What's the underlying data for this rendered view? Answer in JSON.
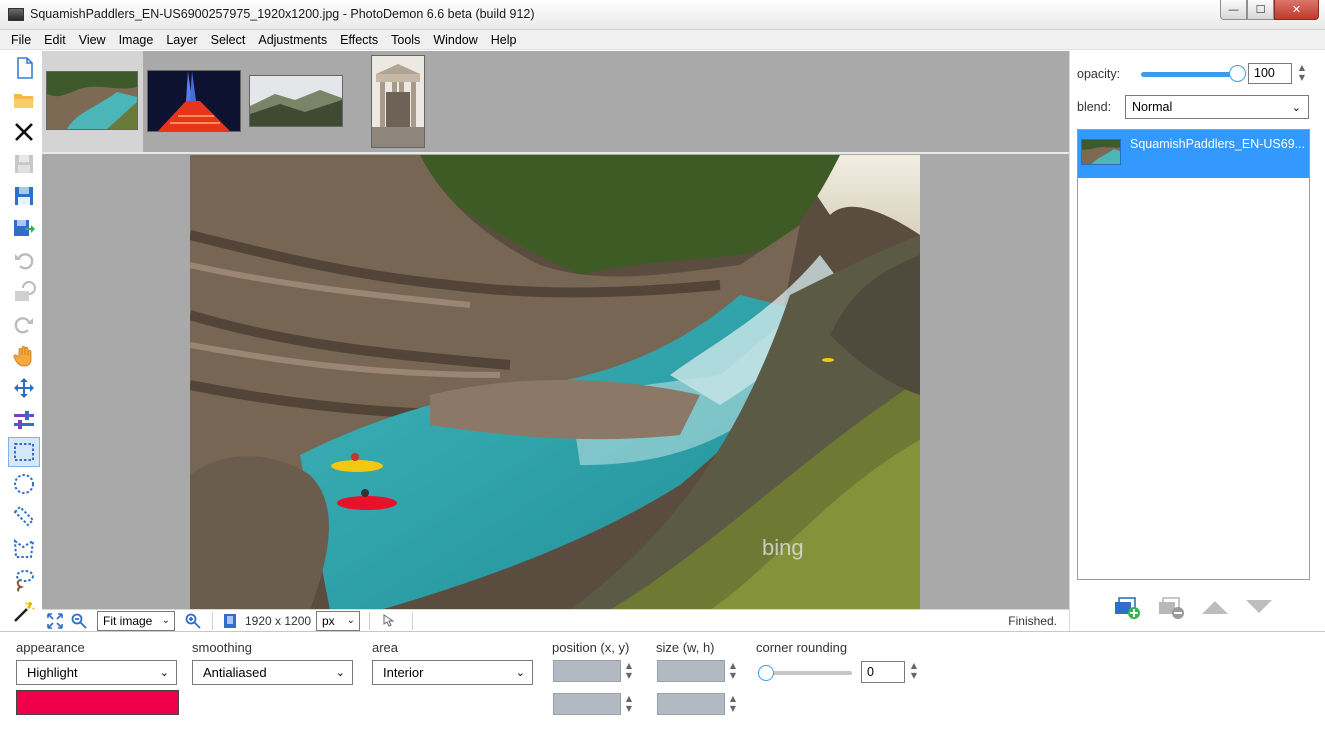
{
  "window": {
    "title": "SquamishPaddlers_EN-US6900257975_1920x1200.jpg  -  PhotoDemon 6.6 beta (build 912)",
    "minimize_glyph": "—",
    "maximize_glyph": "☐",
    "close_glyph": "✕"
  },
  "menu": [
    "File",
    "Edit",
    "View",
    "Image",
    "Layer",
    "Select",
    "Adjustments",
    "Effects",
    "Tools",
    "Window",
    "Help"
  ],
  "tools": [
    {
      "name": "new-image-icon"
    },
    {
      "name": "open-folder-icon"
    },
    {
      "name": "close-image-icon"
    },
    {
      "name": "save-icon"
    },
    {
      "name": "save-as-icon"
    },
    {
      "name": "export-icon"
    },
    {
      "name": "undo-icon"
    },
    {
      "name": "fade-icon"
    },
    {
      "name": "redo-icon"
    },
    {
      "name": "hand-icon"
    },
    {
      "name": "move-icon"
    },
    {
      "name": "color-picker-icon"
    },
    {
      "name": "rect-select-icon"
    },
    {
      "name": "ellipse-select-icon"
    },
    {
      "name": "line-select-icon"
    },
    {
      "name": "polygon-select-icon"
    },
    {
      "name": "lasso-select-icon"
    },
    {
      "name": "magic-wand-icon"
    }
  ],
  "thumbnails": [
    "river canyon",
    "tower at night",
    "mountain valley",
    "classical building"
  ],
  "statusbar": {
    "zoom_mode": "Fit image",
    "image_size": "1920 x 1200",
    "units": "px",
    "status": "Finished."
  },
  "layers_panel": {
    "opacity_label": "opacity:",
    "opacity_value": "100",
    "opacity_fraction": 1.0,
    "blend_label": "blend:",
    "blend_value": "Normal",
    "layer_name": "SquamishPaddlers_EN-US69..."
  },
  "options": {
    "appearance_label": "appearance",
    "appearance_value": "Highlight",
    "highlight_color": "#f0004a",
    "smoothing_label": "smoothing",
    "smoothing_value": "Antialiased",
    "area_label": "area",
    "area_value": "Interior",
    "position_label": "position (x, y)",
    "size_label": "size (w, h)",
    "corner_label": "corner rounding",
    "corner_value": "0",
    "corner_fraction": 0.0
  },
  "photo": {
    "watermark": "bing"
  }
}
